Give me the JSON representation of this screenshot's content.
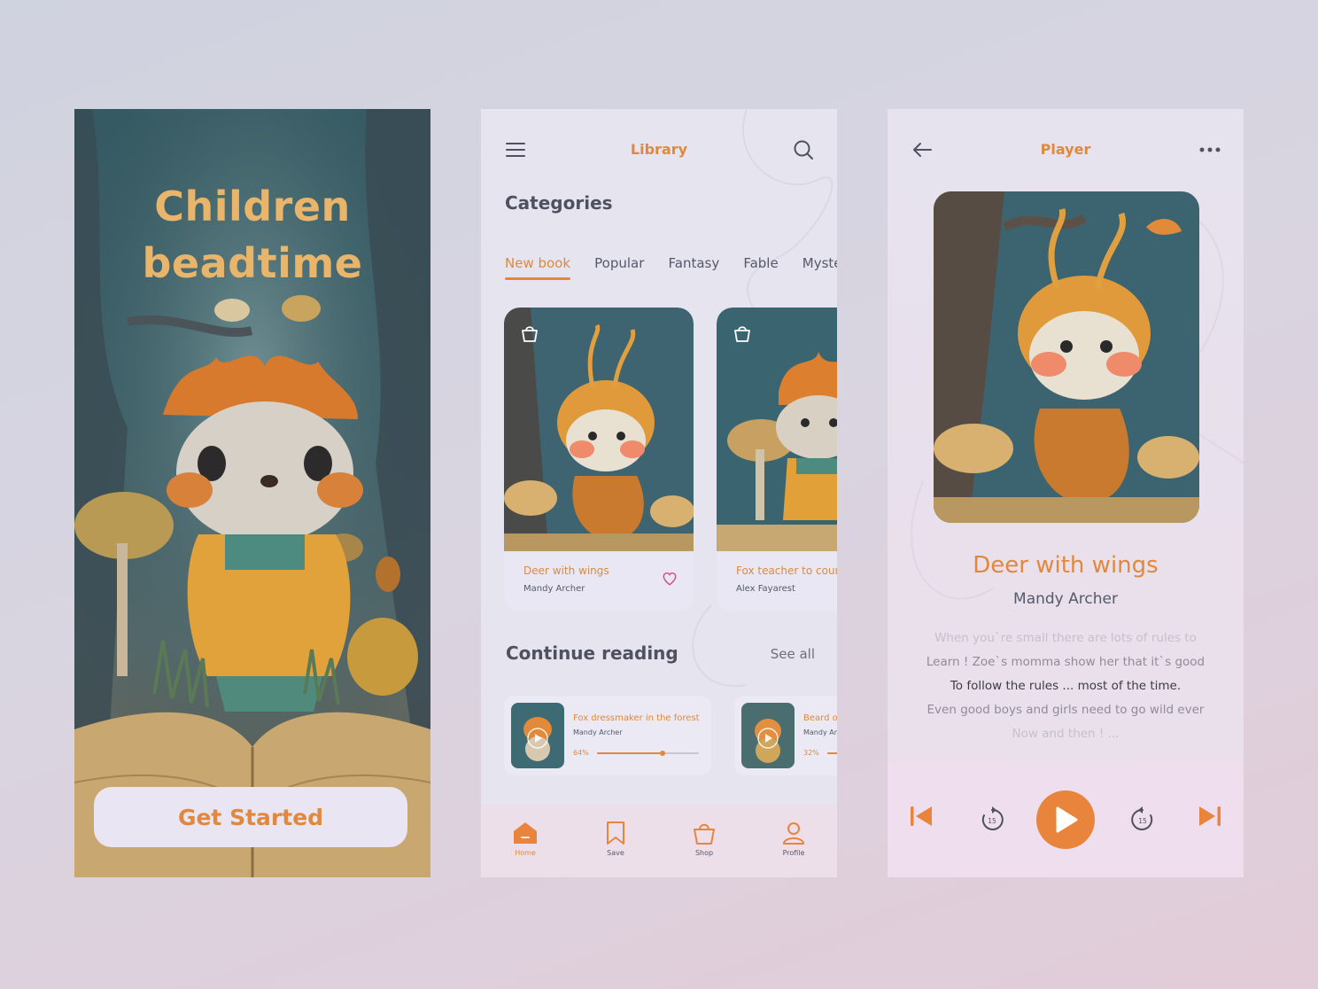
{
  "colors": {
    "accent": "#e0893e",
    "text_dark": "#4f5160",
    "background": "#d9d4e0"
  },
  "welcome": {
    "title_line1": "Children",
    "title_line2": "beadtime",
    "cta_label": "Get Started"
  },
  "library": {
    "title": "Library",
    "menu_icon": "hamburger-icon",
    "search_icon": "search-icon",
    "categories_heading": "Categories",
    "tabs": [
      "New book",
      "Popular",
      "Fantasy",
      "Fable",
      "Myster"
    ],
    "active_tab": "New book",
    "books": [
      {
        "title": "Deer with wings",
        "author": "Mandy Archer"
      },
      {
        "title": "Fox teacher to coun",
        "author": "Alex Fayarest"
      }
    ],
    "continue_heading": "Continue reading",
    "see_all": "See all",
    "continue": [
      {
        "title": "Fox dressmaker in the forest",
        "author": "Mandy Archer",
        "progress_label": "64%",
        "progress": 0.64
      },
      {
        "title": "Beard o",
        "author": "Mandy Ar",
        "progress_label": "32%",
        "progress": 0.32
      }
    ],
    "nav": [
      {
        "label": "Home",
        "icon": "home-icon"
      },
      {
        "label": "Save",
        "icon": "bookmark-icon"
      },
      {
        "label": "Shop",
        "icon": "shopping-bag-icon"
      },
      {
        "label": "Profile",
        "icon": "profile-icon"
      }
    ]
  },
  "player": {
    "title": "Player",
    "book_title": "Deer with wings",
    "author": "Mandy Archer",
    "lyrics": [
      "When you`re small there are lots of rules to",
      "Learn ! Zoe`s  momma show her that it`s good",
      "To follow the rules ... most of the time.",
      "Even good boys and girls need to go  wild ever",
      "Now and then ! ..."
    ],
    "skip_back_seconds": "15",
    "skip_forward_seconds": "15"
  }
}
